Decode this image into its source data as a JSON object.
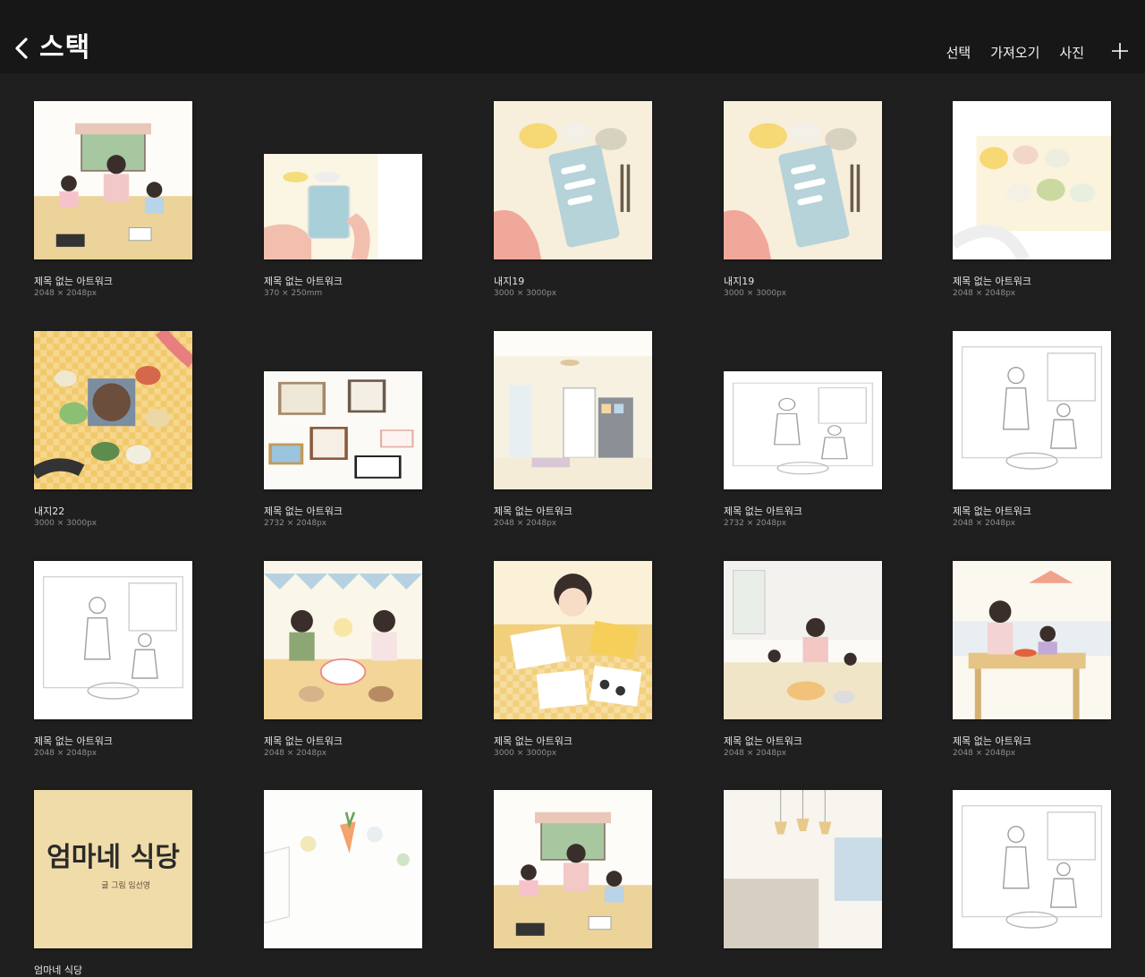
{
  "header": {
    "title": "스택",
    "actions": [
      "선택",
      "가져오기",
      "사진"
    ]
  },
  "colors": {
    "background": "#1f1f1f",
    "topbar": "#171717",
    "text": "#ffffff",
    "subtext": "#8e8e8e"
  },
  "artworks": [
    {
      "title": "제목 없는 아트워크",
      "size": "2048 × 2048px",
      "scene": "kitchen-family"
    },
    {
      "title": "제목 없는 아트워크",
      "size": "370 × 250mm",
      "scene": "phone-hands"
    },
    {
      "title": "내지19",
      "size": "3000 × 3000px",
      "scene": "phone-chat"
    },
    {
      "title": "내지19",
      "size": "3000 × 3000px",
      "scene": "phone-chat"
    },
    {
      "title": "제목 없는 아트워크",
      "size": "2048 × 2048px",
      "scene": "bowls-sketch"
    },
    {
      "title": "내지22",
      "size": "3000 × 3000px",
      "scene": "table-feast"
    },
    {
      "title": "제목 없는 아트워크",
      "size": "2732 × 2048px",
      "scene": "frames-wall"
    },
    {
      "title": "제목 없는 아트워크",
      "size": "2048 × 2048px",
      "scene": "entrance-room"
    },
    {
      "title": "제목 없는 아트워크",
      "size": "2732 × 2048px",
      "scene": "line-sketch"
    },
    {
      "title": "제목 없는 아트워크",
      "size": "2048 × 2048px",
      "scene": "line-sketch"
    },
    {
      "title": "제목 없는 아트워크",
      "size": "2048 × 2048px",
      "scene": "line-sketch"
    },
    {
      "title": "제목 없는 아트워크",
      "size": "2048 × 2048px",
      "scene": "birthday-party"
    },
    {
      "title": "제목 없는 아트워크",
      "size": "3000 × 3000px",
      "scene": "lunchbox"
    },
    {
      "title": "제목 없는 아트워크",
      "size": "2048 × 2048px",
      "scene": "kitchen-baking"
    },
    {
      "title": "제목 없는 아트워크",
      "size": "2048 × 2048px",
      "scene": "dining-room"
    },
    {
      "title": "엄마네 식당",
      "size": "",
      "scene": "cover-title",
      "cover_text": "엄마네 식당",
      "cover_sub": "글 그림 임선영"
    },
    {
      "title": "",
      "size": "",
      "scene": "vegetables"
    },
    {
      "title": "",
      "size": "",
      "scene": "kitchen-family"
    },
    {
      "title": "",
      "size": "",
      "scene": "kitchen-lights"
    },
    {
      "title": "",
      "size": "",
      "scene": "line-sketch"
    }
  ]
}
